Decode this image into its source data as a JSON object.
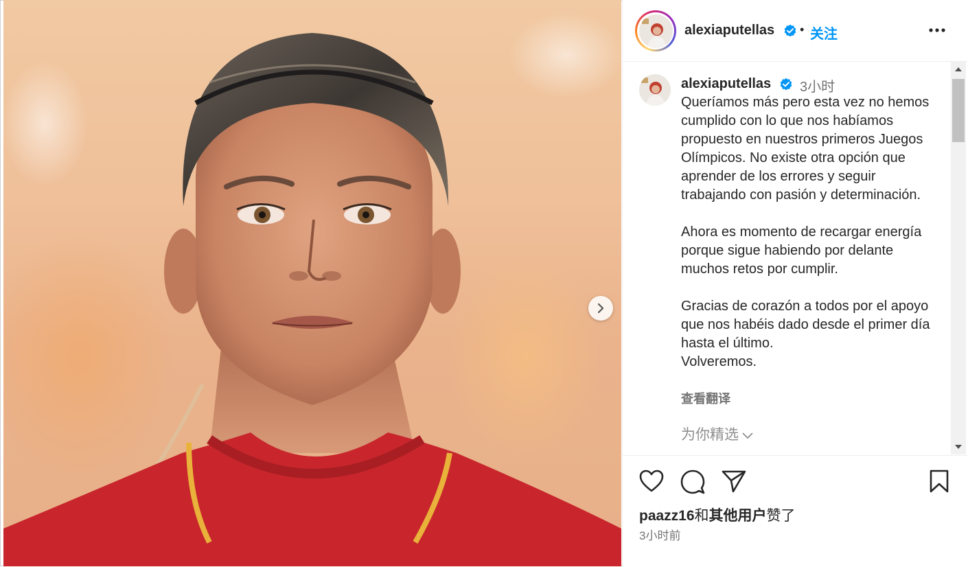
{
  "post": {
    "username": "alexiaputellas",
    "dot": "•",
    "follow_label": "关注"
  },
  "caption": {
    "username": "alexiaputellas",
    "time": "3小时",
    "text": "Queríamos más pero esta vez no hemos cumplido con lo que nos habíamos propuesto en nuestros primeros Juegos Olímpicos. No existe otra opción que aprender de los errores y seguir trabajando con pasión y determinación.\n\nAhora es momento de recargar energía porque sigue habiendo por delante muchos retos por cumplir.\n\nGracias de corazón a todos por el apoyo que nos habéis dado desde el primer día hasta el último.\nVolveremos.",
    "translate_label": "查看翻译",
    "for_you_label": "为你精选"
  },
  "likes": {
    "user": "paazz16",
    "connector": "和",
    "others": "其他用户",
    "suffix": "赞了"
  },
  "post_time": "3小时前",
  "colors": {
    "accent": "#0095f6",
    "verified": "#0095f6",
    "jersey_red": "#c8262c",
    "jersey_gold": "#e9b23a"
  },
  "icons": {
    "more": "more-horizontal-icon",
    "like": "heart-icon",
    "comment": "comment-icon",
    "share": "send-icon",
    "save": "bookmark-icon",
    "next": "chevron-right-icon",
    "verified": "verified-badge-icon"
  }
}
